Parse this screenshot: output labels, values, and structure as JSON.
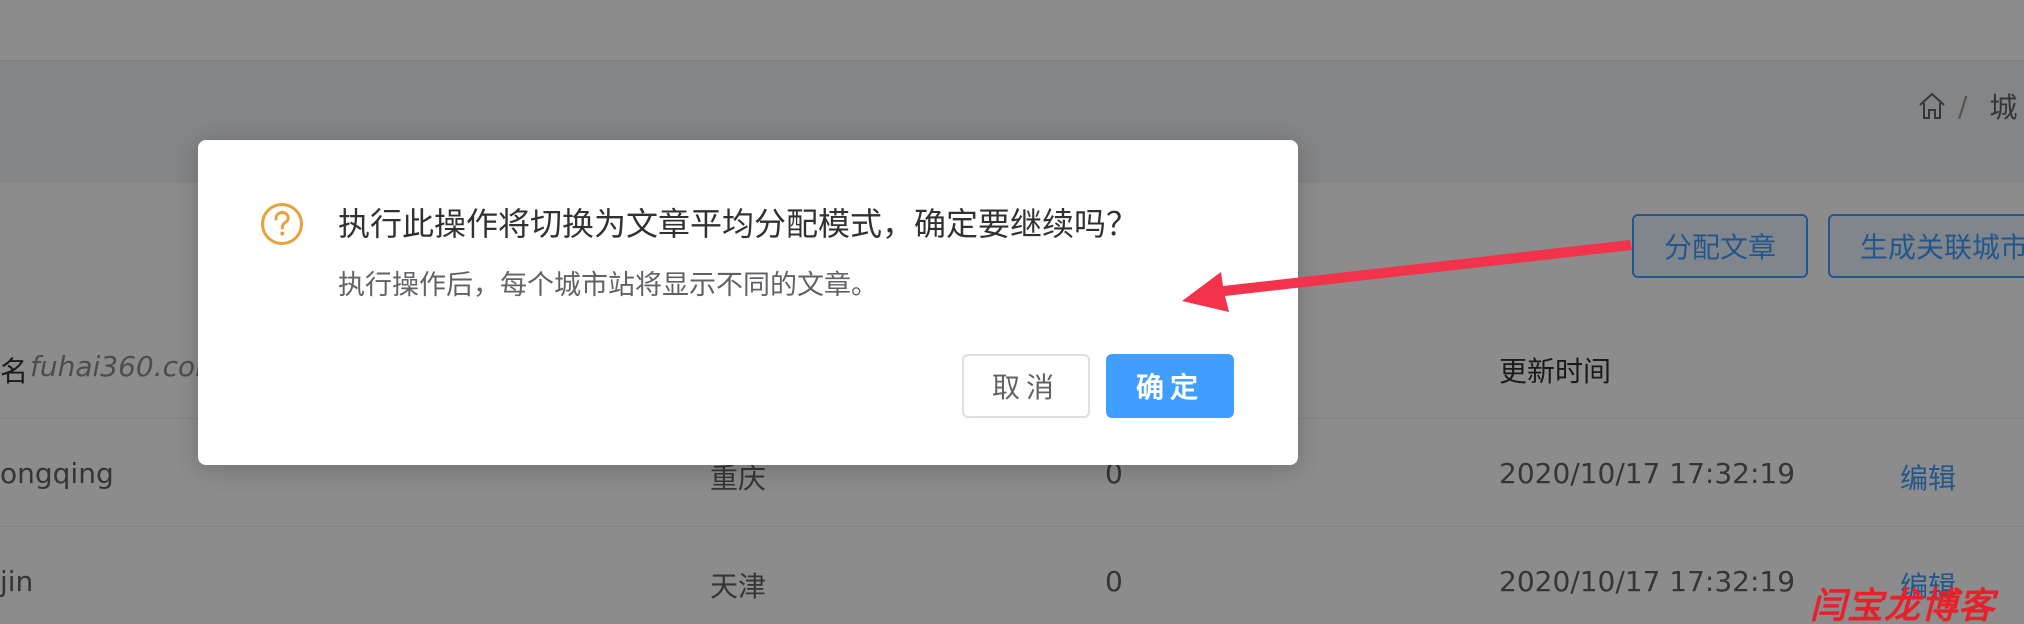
{
  "breadcrumb": {
    "home_icon": "home-icon",
    "separator": "/",
    "current": "城"
  },
  "toolbar": {
    "assign_label": "分配文章",
    "generate_label": "生成关联城市"
  },
  "table": {
    "headers": {
      "name_prefix": "名",
      "name_watermark": "fuhai360.com",
      "updated": "更新时间"
    },
    "rows": [
      {
        "pinyin": "ongqing",
        "city": "重庆",
        "count": "0",
        "time": "2020/10/17 17:32:19",
        "action": "编辑"
      },
      {
        "pinyin": "jin",
        "city": "天津",
        "count": "0",
        "time": "2020/10/17 17:32:19",
        "action": "编辑"
      }
    ]
  },
  "dialog": {
    "icon": "question-circle-icon",
    "icon_color": "#e6a23c",
    "title": "执行此操作将切换为文章平均分配模式，确定要继续吗？",
    "message": "执行操作后，每个城市站将显示不同的文章。",
    "cancel_label": "取消",
    "confirm_label": "确定"
  },
  "annotation": {
    "arrow_color": "#f2334b"
  },
  "watermark": "闫宝龙博客",
  "colors": {
    "primary": "#409eff",
    "mask": "rgba(0,0,0,0.45)"
  }
}
